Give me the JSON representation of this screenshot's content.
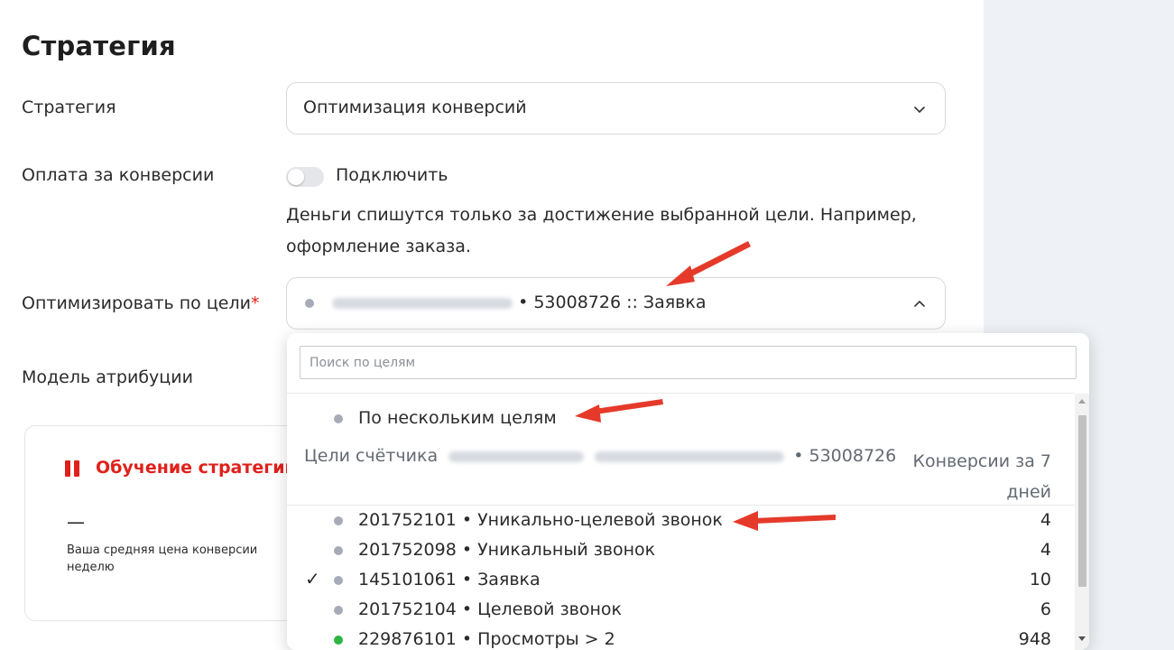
{
  "page": {
    "title": "Стратегия",
    "strategy_label": "Стратегия",
    "strategy_value": "Оптимизация конверсий",
    "pay_label": "Оплата за конверсии",
    "pay_toggle_label": "Подключить",
    "pay_hint": "Деньги спишутся только за достижение выбранной цели. Например, оформление заказа.",
    "goal_label": "Оптимизировать по цели",
    "goal_required_mark": "*",
    "goal_value": "• 53008726 :: Заявка",
    "attribution_label": "Модель атрибуции"
  },
  "learning_card": {
    "title": "Обучение стратегии",
    "dash": "—",
    "description": "Ваша средняя цена конверсии неделю"
  },
  "dropdown": {
    "search_placeholder": "Поиск по целям",
    "multi_goal_label": "По нескольким целям",
    "group_label_prefix": "Цели счётчика",
    "group_label_suffix": "• 53008726",
    "group_right_label": "Конверсии за 7 дней",
    "goals": [
      {
        "label": "201752101 • Уникально-целевой звонок",
        "count": "4",
        "checked": false,
        "dot": "gray"
      },
      {
        "label": "201752098 • Уникальный звонок",
        "count": "4",
        "checked": false,
        "dot": "gray"
      },
      {
        "label": "145101061 • Заявка",
        "count": "10",
        "checked": true,
        "check_mark": "✓",
        "dot": "gray"
      },
      {
        "label": "201752104 • Целевой звонок",
        "count": "6",
        "checked": false,
        "dot": "gray"
      },
      {
        "label": "229876101 • Просмотры > 2",
        "count": "948",
        "checked": false,
        "dot": "green"
      }
    ]
  },
  "colors": {
    "accent_red": "#e0211b",
    "dot_gray": "#a6acb7",
    "dot_green": "#2fb543",
    "side_panel": "#eef1f5"
  },
  "icons": [
    "chevron-down-icon",
    "chevron-up-icon",
    "checkmark-icon",
    "pause-icon",
    "annotation-arrow-icon"
  ]
}
